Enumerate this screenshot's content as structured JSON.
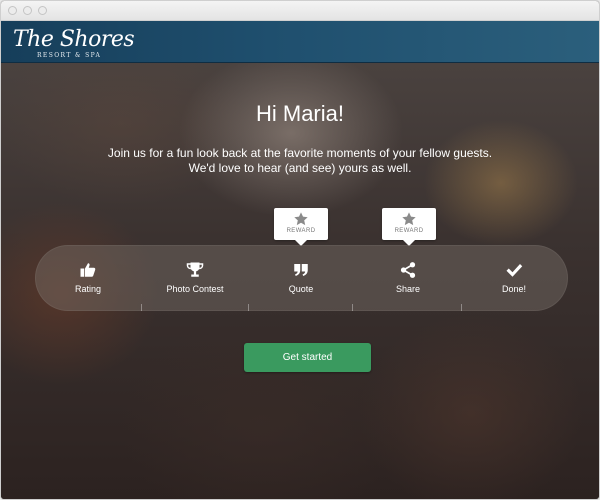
{
  "header": {
    "logo_main": "The Shores",
    "logo_sub": "RESORT & SPA",
    "background_color": "#1f4f6e"
  },
  "greeting": "Hi Maria!",
  "intro_lines": [
    "Join us for a fun look back at the favorite moments of your fellow guests.",
    "We'd love to hear (and see) yours as well."
  ],
  "rewards": [
    {
      "label": "REWARD",
      "icon": "star-icon",
      "step": "Quote"
    },
    {
      "label": "REWARD",
      "icon": "star-icon",
      "step": "Share"
    }
  ],
  "steps": [
    {
      "label": "Rating",
      "icon": "thumbs-up-icon"
    },
    {
      "label": "Photo Contest",
      "icon": "trophy-icon"
    },
    {
      "label": "Quote",
      "icon": "quote-icon"
    },
    {
      "label": "Share",
      "icon": "share-icon"
    },
    {
      "label": "Done!",
      "icon": "check-icon"
    }
  ],
  "cta": {
    "label": "Get started",
    "color": "#3a9a5f"
  }
}
